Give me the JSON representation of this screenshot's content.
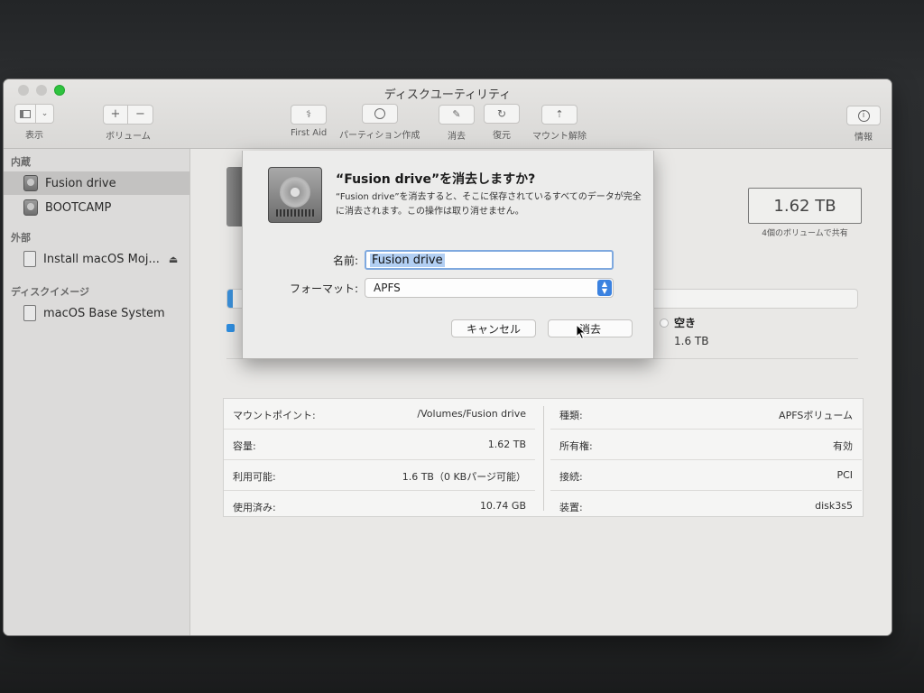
{
  "window": {
    "title": "ディスクユーティリティ"
  },
  "toolbar": {
    "view_label": "表示",
    "volume_label": "ボリューム",
    "add_symbol": "+",
    "remove_symbol": "−",
    "firstaid_label": "First Aid",
    "partition_label": "パーティション作成",
    "erase_label": "消去",
    "restore_label": "復元",
    "unmount_label": "マウント解除",
    "info_label": "情報"
  },
  "sidebar": {
    "section_internal": "内蔵",
    "section_external": "外部",
    "section_images": "ディスクイメージ",
    "items": [
      {
        "label": "Fusion drive"
      },
      {
        "label": "BOOTCAMP"
      },
      {
        "label": "Install macOS Moj..."
      },
      {
        "label": "macOS Base System"
      }
    ],
    "eject_symbol": "⏏"
  },
  "main": {
    "capacity": "1.62 TB",
    "capacity_sub": "4個のボリュームで共有",
    "free_label": "空き",
    "free_value": "1.6 TB",
    "usage_fraction": 0.007
  },
  "info": {
    "left": [
      {
        "key": "マウントポイント:",
        "value": "/Volumes/Fusion drive"
      },
      {
        "key": "容量:",
        "value": "1.62 TB"
      },
      {
        "key": "利用可能:",
        "value": "1.6 TB（0 KBパージ可能）"
      },
      {
        "key": "使用済み:",
        "value": "10.74 GB"
      }
    ],
    "right": [
      {
        "key": "種類:",
        "value": "APFSボリューム"
      },
      {
        "key": "所有権:",
        "value": "有効"
      },
      {
        "key": "接続:",
        "value": "PCI"
      },
      {
        "key": "装置:",
        "value": "disk3s5"
      }
    ]
  },
  "dialog": {
    "title": "“Fusion drive”を消去しますか?",
    "message": "“Fusion drive”を消去すると、そこに保存されているすべてのデータが完全に消去されます。この操作は取り消せません。",
    "name_label": "名前:",
    "name_value": "Fusion drive",
    "format_label": "フォーマット:",
    "format_value": "APFS",
    "cancel_label": "キャンセル",
    "erase_label": "消去"
  },
  "colors": {
    "accent": "#3b82e0",
    "usage_used": "#3a8fd9",
    "maximize": "#2ec33f"
  }
}
